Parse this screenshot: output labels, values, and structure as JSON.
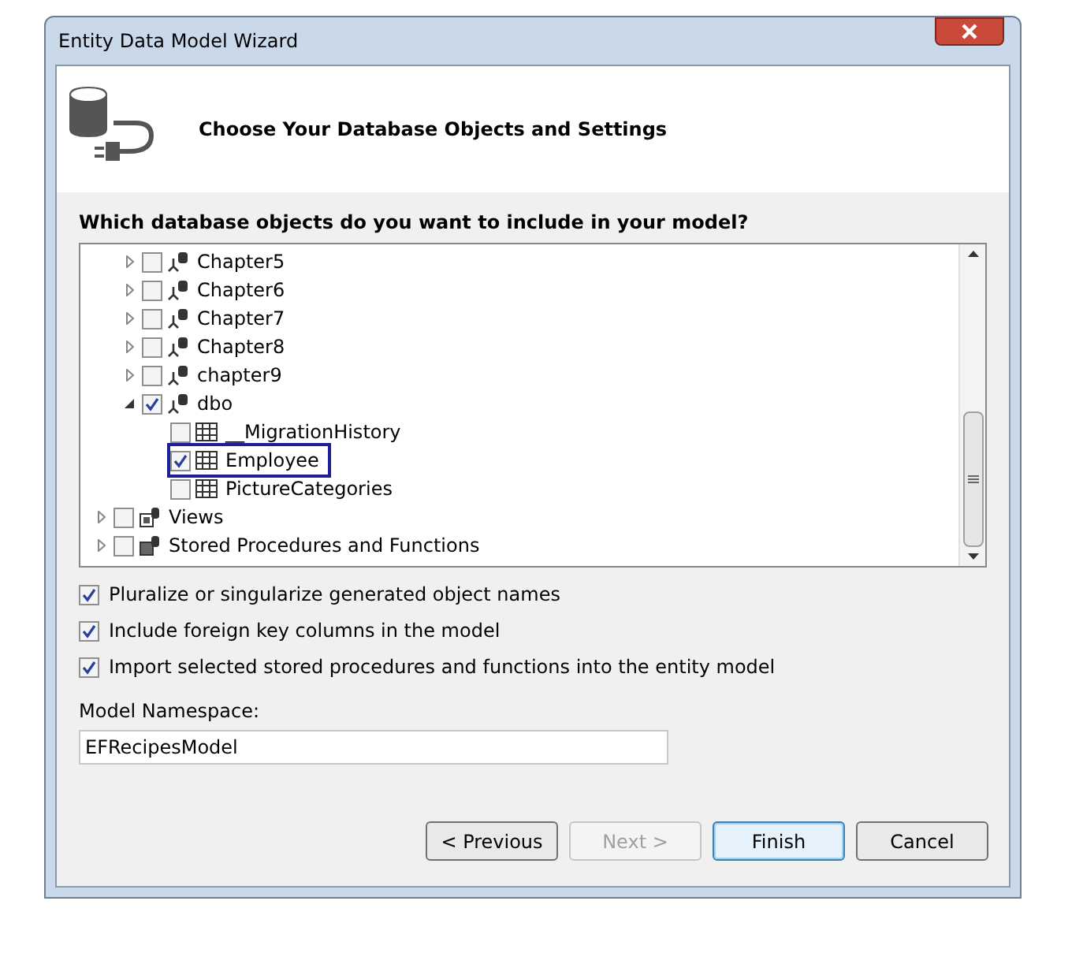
{
  "window": {
    "title": "Entity Data Model Wizard"
  },
  "header": {
    "title": "Choose Your Database Objects and Settings"
  },
  "tree_prompt": "Which database objects do you want to include in your model?",
  "tree": {
    "items": [
      {
        "children": [
          {
            "label": "Chapter5",
            "kind": "schema",
            "checked": false,
            "expanded": false
          },
          {
            "label": "Chapter6",
            "kind": "schema",
            "checked": false,
            "expanded": false
          },
          {
            "label": "Chapter7",
            "kind": "schema",
            "checked": false,
            "expanded": false
          },
          {
            "label": "Chapter8",
            "kind": "schema",
            "checked": false,
            "expanded": false
          },
          {
            "label": "chapter9",
            "kind": "schema",
            "checked": false,
            "expanded": false
          },
          {
            "label": "dbo",
            "kind": "schema",
            "checked": true,
            "expanded": true,
            "children": [
              {
                "label": "__MigrationHistory",
                "kind": "table",
                "checked": false,
                "highlighted": false
              },
              {
                "label": "Employee",
                "kind": "table",
                "checked": true,
                "highlighted": true
              },
              {
                "label": "PictureCategories",
                "kind": "table",
                "checked": false,
                "highlighted": false
              }
            ]
          }
        ]
      },
      {
        "label": "Views",
        "kind": "views",
        "checked": false,
        "expanded": false
      },
      {
        "label": "Stored Procedures and Functions",
        "kind": "procedures",
        "checked": false,
        "expanded": false
      }
    ]
  },
  "options": [
    {
      "label": "Pluralize or singularize generated object names",
      "checked": true
    },
    {
      "label": "Include foreign key columns in the model",
      "checked": true
    },
    {
      "label": "Import selected stored procedures and functions into the entity model",
      "checked": true
    }
  ],
  "namespace": {
    "label": "Model Namespace:",
    "value": "EFRecipesModel"
  },
  "buttons": [
    {
      "label": "< Previous",
      "disabled": false,
      "default": false
    },
    {
      "label": "Next >",
      "disabled": true,
      "default": false
    },
    {
      "label": "Finish",
      "disabled": false,
      "default": true
    },
    {
      "label": "Cancel",
      "disabled": false,
      "default": false
    }
  ]
}
